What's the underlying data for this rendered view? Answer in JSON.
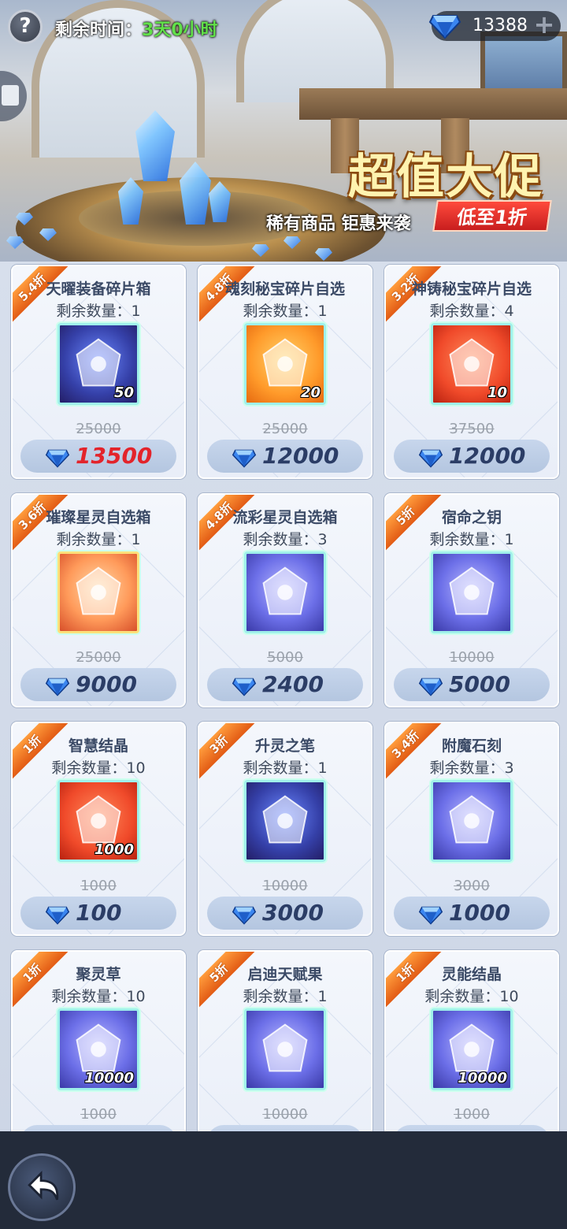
{
  "header": {
    "help_icon": "question-mark-icon",
    "help_label": "?",
    "timer_label": "剩余时间：",
    "timer_value": "3天0小时",
    "currency_icon": "diamond-icon",
    "currency_amount": "13388",
    "currency_add": "+"
  },
  "promo": {
    "title": "超值大促",
    "subtitle": "稀有商品 钜惠来袭",
    "badge": "低至1折"
  },
  "colors": {
    "accent_red": "#e3242b",
    "timer_green": "#62e04a",
    "ribbon_orange": "#ff9c3c"
  },
  "items": [
    {
      "discount": "5.4折",
      "name": "天曜装备碎片箱",
      "qty": "剩余数量：1",
      "count": "50",
      "old_price": "25000",
      "price": "13500",
      "icon": "golden-armor-icon"
    },
    {
      "discount": "4.8折",
      "name": "魂刻秘宝碎片自选",
      "qty": "剩余数量：1",
      "count": "20",
      "old_price": "25000",
      "price": "12000",
      "icon": "treasure-artifact-icon"
    },
    {
      "discount": "3.2折",
      "name": "神铸秘宝碎片自选",
      "qty": "剩余数量：4",
      "count": "10",
      "old_price": "37500",
      "price": "12000",
      "icon": "treasure-artifact-icon"
    },
    {
      "discount": "3.6折",
      "name": "璀璨星灵自选箱",
      "qty": "剩余数量：1",
      "count": "",
      "old_price": "25000",
      "price": "9000",
      "icon": "star-spirit-chest-icon"
    },
    {
      "discount": "4.8折",
      "name": "流彩星灵自选箱",
      "qty": "剩余数量：3",
      "count": "",
      "old_price": "5000",
      "price": "2400",
      "icon": "star-spirit-chest-icon"
    },
    {
      "discount": "5折",
      "name": "宿命之钥",
      "qty": "剩余数量：1",
      "count": "",
      "old_price": "10000",
      "price": "5000",
      "icon": "key-icon"
    },
    {
      "discount": "1折",
      "name": "智慧结晶",
      "qty": "剩余数量：10",
      "count": "1000",
      "old_price": "1000",
      "price": "100",
      "icon": "dark-crystal-icon"
    },
    {
      "discount": "3折",
      "name": "升灵之笔",
      "qty": "剩余数量：1",
      "count": "",
      "old_price": "10000",
      "price": "3000",
      "icon": "feather-pen-icon"
    },
    {
      "discount": "3.4折",
      "name": "附魔石刻",
      "qty": "剩余数量：3",
      "count": "",
      "old_price": "3000",
      "price": "1000",
      "icon": "rune-stone-icon"
    },
    {
      "discount": "1折",
      "name": "聚灵草",
      "qty": "剩余数量：10",
      "count": "10000",
      "old_price": "1000",
      "price": "",
      "icon": "spirit-herb-icon"
    },
    {
      "discount": "5折",
      "name": "启迪天赋果",
      "qty": "剩余数量：1",
      "count": "",
      "old_price": "10000",
      "price": "",
      "icon": "talent-fruit-icon"
    },
    {
      "discount": "1折",
      "name": "灵能结晶",
      "qty": "剩余数量：10",
      "count": "10000",
      "old_price": "1000",
      "price": "",
      "icon": "psionic-crystal-icon"
    }
  ],
  "footer": {
    "back_icon": "back-arrow-icon"
  }
}
